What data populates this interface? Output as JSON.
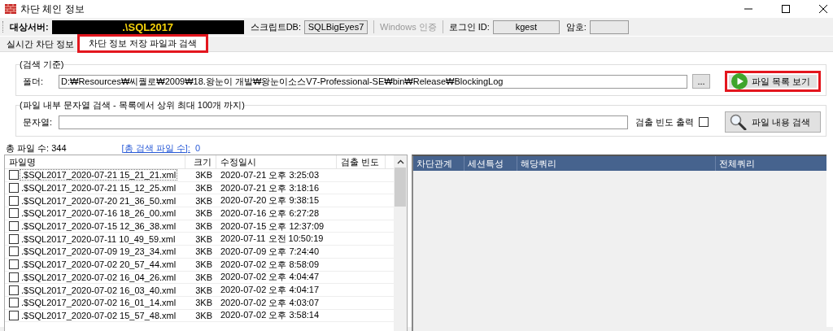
{
  "window": {
    "title": "차단 체인 정보"
  },
  "toolbar": {
    "server_label": "대상서버:",
    "server_value": ".\\SQL2017",
    "script_db_label": "스크립트DB:",
    "script_db_value": "SQLBigEyes7",
    "windows_auth": {
      "label": "Windows 인증",
      "disabled": true
    },
    "login_label": "로그인 ID:",
    "login_value": "kgest",
    "password_label": "암호:"
  },
  "tabs": [
    {
      "label": "실시간 차단 정보",
      "selected": false,
      "highlighted": false
    },
    {
      "label": "차단 정보 저장 파일과 검색",
      "selected": true,
      "highlighted": true
    }
  ],
  "search_criteria": {
    "legend": "(검색 기준)",
    "folder_label": "폴더:",
    "folder_value": "D:₩Resources₩씨퀄로₩2009₩18.왕눈이 개발₩왕눈이소스V7-Professional-SE₩bin₩Release₩BlockingLog",
    "browse_button": "...",
    "list_button": {
      "label": "파일 목록 보기",
      "highlighted": true
    }
  },
  "content_search": {
    "legend": "(파일 내부 문자열 검색 - 목록에서 상위 최대 100개 까지)",
    "string_label": "문자열:",
    "frequency_label": "검출 빈도 출력",
    "frequency_checked": false,
    "search_button": "파일 내용 검색"
  },
  "summary": {
    "total_label": "총 파일 수:",
    "total_value": "344",
    "found_link": "[총 검색 파일 수]:",
    "found_value": "0"
  },
  "file_table": {
    "columns": [
      "파일명",
      "크기",
      "수정일시",
      "검출 빈도"
    ],
    "rows": [
      {
        "checked": false,
        "focused": true,
        "name": ".$SQL2017_2020-07-21 15_21_21.xml",
        "size": "3KB",
        "modified": "2020-07-21 오후 3:25:03"
      },
      {
        "checked": false,
        "focused": false,
        "name": ".$SQL2017_2020-07-21 15_12_25.xml",
        "size": "3KB",
        "modified": "2020-07-21 오후 3:18:16"
      },
      {
        "checked": false,
        "focused": false,
        "name": ".$SQL2017_2020-07-20 21_36_50.xml",
        "size": "3KB",
        "modified": "2020-07-20 오후 9:38:15"
      },
      {
        "checked": false,
        "focused": false,
        "name": ".$SQL2017_2020-07-16 18_26_00.xml",
        "size": "3KB",
        "modified": "2020-07-16 오후 6:27:28"
      },
      {
        "checked": false,
        "focused": false,
        "name": ".$SQL2017_2020-07-15 12_36_38.xml",
        "size": "3KB",
        "modified": "2020-07-15 오후 12:37:09"
      },
      {
        "checked": false,
        "focused": false,
        "name": ".$SQL2017_2020-07-11 10_49_59.xml",
        "size": "3KB",
        "modified": "2020-07-11 오전 10:50:19"
      },
      {
        "checked": false,
        "focused": false,
        "name": ".$SQL2017_2020-07-09 19_23_34.xml",
        "size": "3KB",
        "modified": "2020-07-09 오후 7:24:40"
      },
      {
        "checked": false,
        "focused": false,
        "name": ".$SQL2017_2020-07-02 20_57_44.xml",
        "size": "3KB",
        "modified": "2020-07-02 오후 8:58:09"
      },
      {
        "checked": false,
        "focused": false,
        "name": ".$SQL2017_2020-07-02 16_04_26.xml",
        "size": "3KB",
        "modified": "2020-07-02 오후 4:04:47"
      },
      {
        "checked": false,
        "focused": false,
        "name": ".$SQL2017_2020-07-02 16_03_40.xml",
        "size": "3KB",
        "modified": "2020-07-02 오후 4:04:17"
      },
      {
        "checked": false,
        "focused": false,
        "name": ".$SQL2017_2020-07-02 16_01_14.xml",
        "size": "3KB",
        "modified": "2020-07-02 오후 4:03:07"
      },
      {
        "checked": false,
        "focused": false,
        "name": ".$SQL2017_2020-07-02 15_57_48.xml",
        "size": "3KB",
        "modified": "2020-07-02 오후 3:58:14"
      }
    ]
  },
  "result_table": {
    "columns": [
      "차단관계",
      "세션특성",
      "해당쿼리",
      "전체쿼리"
    ]
  }
}
